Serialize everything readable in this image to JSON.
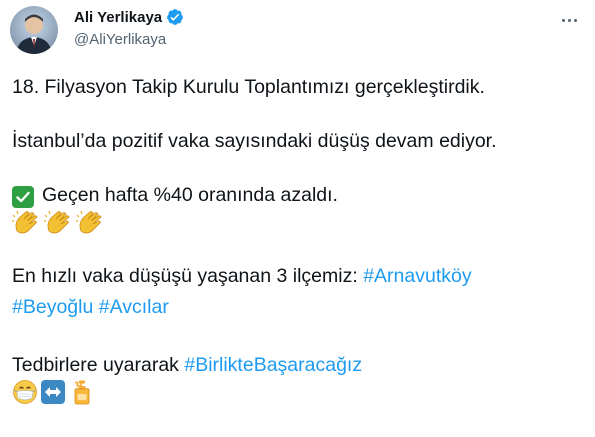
{
  "author": {
    "name": "Ali Yerlikaya",
    "handle": "@AliYerlikaya"
  },
  "tweet": {
    "line1": "18. Filyasyon Takip Kurulu Toplantımızı gerçekleştirdik.",
    "line2": "İstanbul’da pozitif vaka sayısındaki düşüş devam ediyor.",
    "line3": "Geçen hafta %40 oranında azaldı.",
    "line4_text": "En hızlı vaka düşüşü yaşanan 3 ilçemiz: ",
    "hashtag_arnavutkoy": "#Arnavutköy",
    "hashtag_beyoglu": "#Beyoğlu",
    "hashtag_avcilar": "#Avcılar",
    "line6_text": "Tedbirlere uyararak ",
    "hashtag_birlikte": "#BirlikteBaşaracağız"
  },
  "icons": {
    "verified": "verified-badge-icon",
    "more": "more-options-icon",
    "check": "check-mark-emoji",
    "clap": "clapping-hands-emoji",
    "mask": "face-with-mask-emoji",
    "arrows": "left-right-arrow-emoji",
    "sanitizer": "lotion-bottle-emoji"
  },
  "colors": {
    "hashtag": "#1d9bf0",
    "verified": "#1d9bf0",
    "check_green": "#2ea043"
  }
}
